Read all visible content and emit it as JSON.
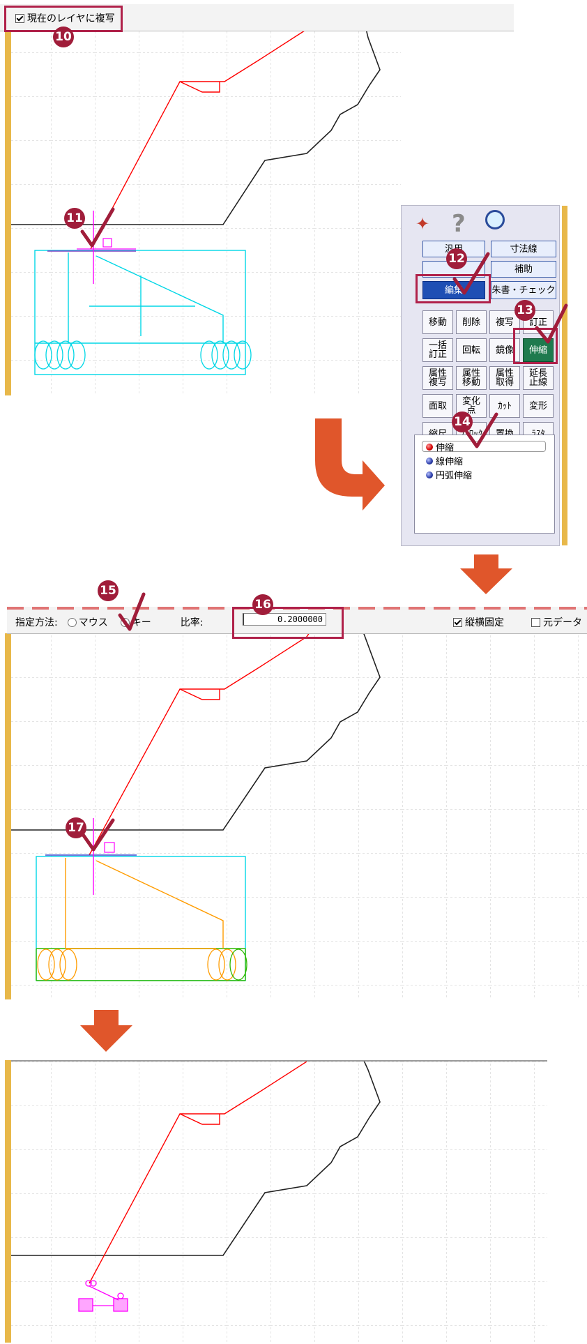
{
  "top_toolbar": {
    "checkbox_label": "現在のレイヤに複写",
    "checkbox_checked": true
  },
  "steps": [
    "10",
    "11",
    "12",
    "13",
    "14",
    "15",
    "16",
    "17"
  ],
  "palette": {
    "icons": [
      "pin-icon",
      "help-icon",
      "zoom-icon"
    ],
    "rows": [
      [
        "汎用",
        "寸法線"
      ],
      [
        "",
        "補助"
      ],
      [
        "編集",
        "朱書・チェック"
      ]
    ],
    "grid": [
      [
        "移動",
        "削除",
        "複写",
        "訂正"
      ],
      [
        "一括\n訂正",
        "回転",
        "鏡像",
        "伸縮"
      ],
      [
        "属性\n複写",
        "属性\n移動",
        "属性\n取得",
        "延長\n止線"
      ],
      [
        "面取",
        "変化\n点",
        "ｶｯﾄ",
        "変形"
      ],
      [
        "縮尺",
        "ﾌﾞﾛｯｸ",
        "置換",
        "ﾗｽﾀ"
      ]
    ],
    "sub_options": [
      "伸縮",
      "線伸縮",
      "円弧伸縮"
    ],
    "selected_sub": "伸縮"
  },
  "mid_toolbar": {
    "method_label": "指定方法:",
    "radio_mouse": "マウス",
    "radio_key": "キー",
    "radio_selected": "キー",
    "ratio_label": "比率:",
    "ratio_value": "0.2000000",
    "fix_label": "縦横固定",
    "fix_checked": true,
    "orig_label": "元データ",
    "orig_checked": false
  },
  "colors": {
    "accent": "#b0214a",
    "arrow": "#e0562b",
    "gold": "#e8b84a",
    "drawing_red": "#ff0000",
    "drawing_cyan": "#00d7e6",
    "drawing_orange": "#ff9c00",
    "drawing_magenta": "#ff00ff",
    "drawing_green": "#2fb900"
  }
}
